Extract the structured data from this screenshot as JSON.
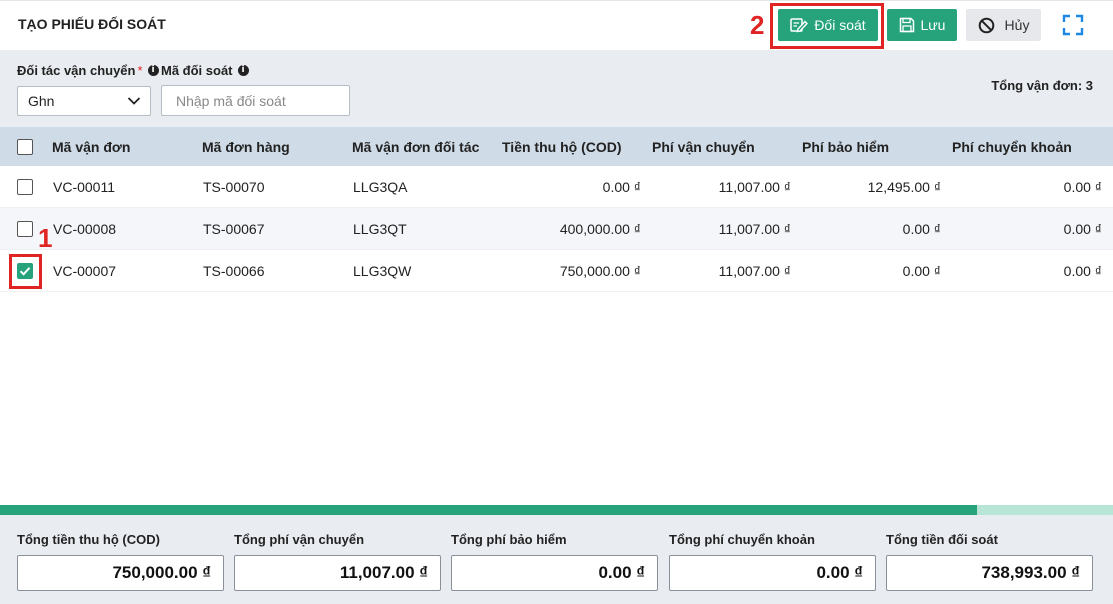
{
  "header": {
    "title": "TẠO PHIẾU ĐỐI SOÁT",
    "reconcile_label": "Đối soát",
    "save_label": "Lưu",
    "cancel_label": "Hủy",
    "step_marker_2": "2"
  },
  "filters": {
    "carrier_label": "Đối tác vận chuyển",
    "required_mark": "*",
    "carrier_value": "Ghn",
    "code_label": "Mã đối soát",
    "code_placeholder": "Nhập mã đối soát",
    "code_value": "",
    "total_count": "Tổng vận đơn: 3"
  },
  "table": {
    "columns": [
      "Mã vận đơn",
      "Mã đơn hàng",
      "Mã vận đơn đối tác",
      "Tiền thu hộ (COD)",
      "Phí vận chuyển",
      "Phí bảo hiểm",
      "Phí chuyển khoản"
    ],
    "rows": [
      {
        "checked": false,
        "cells": [
          "VC-00011",
          "TS-00070",
          "LLG3QA",
          "0.00 ₫",
          "11,007.00 ₫",
          "12,495.00 ₫",
          "0.00 ₫"
        ]
      },
      {
        "checked": false,
        "cells": [
          "VC-00008",
          "TS-00067",
          "LLG3QT",
          "400,000.00 ₫",
          "11,007.00 ₫",
          "0.00 ₫",
          "0.00 ₫"
        ]
      },
      {
        "checked": true,
        "cells": [
          "VC-00007",
          "TS-00066",
          "LLG3QW",
          "750,000.00 ₫",
          "11,007.00 ₫",
          "0.00 ₫",
          "0.00 ₫"
        ]
      }
    ],
    "step_marker_1": "1"
  },
  "scroll_progress": 0.878,
  "totals": [
    {
      "label": "Tổng tiền thu hộ (COD)",
      "value": "750,000.00 ₫"
    },
    {
      "label": "Tổng phí vận chuyển",
      "value": "11,007.00 ₫"
    },
    {
      "label": "Tổng phí bảo hiểm",
      "value": "0.00 ₫"
    },
    {
      "label": "Tổng phí chuyển khoản",
      "value": "0.00 ₫"
    },
    {
      "label": "Tổng tiền đối soát",
      "value": "738,993.00 ₫"
    }
  ],
  "colors": {
    "primary": "#26a37a",
    "highlight": "#e02424",
    "header_row": "#cfdbe7",
    "panel": "#e9ecf0"
  },
  "icons": {
    "reconcile": "edit-note-icon",
    "save": "floppy-disk-icon",
    "cancel": "ban-circle-icon",
    "expand": "fullscreen-icon",
    "info": "info-circle-icon",
    "dropdown": "chevron-down-icon",
    "check": "check-icon"
  }
}
